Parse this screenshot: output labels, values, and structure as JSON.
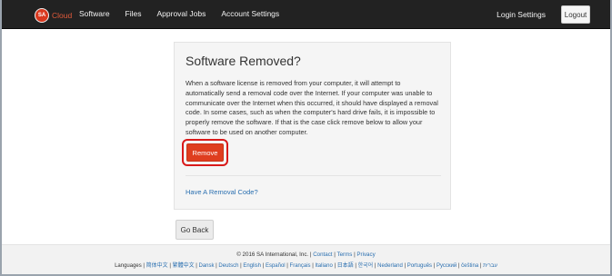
{
  "navbar": {
    "brand_logo_text": "SA",
    "brand_text": "Cloud",
    "links": [
      "Software",
      "Files",
      "Approval Jobs",
      "Account Settings"
    ],
    "login_settings": "Login Settings",
    "logout": "Logout"
  },
  "panel": {
    "title": "Software Removed?",
    "body": "When a software license is removed from your computer, it will attempt to automatically send a removal code over the Internet. If your computer was unable to communicate over the Internet when this occurred, it should have displayed a removal code. In some cases, such as when the computer's hard drive fails, it is impossible to properly remove the software. If that is the case click remove below to allow your software to be used on another computer.",
    "remove_button": "Remove",
    "removal_code_link": "Have A Removal Code?"
  },
  "go_back_button": "Go Back",
  "footer": {
    "copyright": "© 2016 SA International, Inc. |",
    "links": [
      "Contact",
      "Terms",
      "Privacy"
    ],
    "languages_label": "Languages |",
    "languages": [
      "简体中文",
      "繁體中文",
      "Dansk",
      "Deutsch",
      "English",
      "Español",
      "Français",
      "Italiano",
      "日本語",
      "한국어",
      "Nederland",
      "Português",
      "Русский",
      "čeština",
      "עברית"
    ]
  },
  "colors": {
    "navbar_bg": "#222222",
    "brand_accent": "#e05a3a",
    "remove_button_bg": "#df3e1f",
    "highlight_outline": "#d91a1a",
    "link": "#2a6fb0"
  }
}
